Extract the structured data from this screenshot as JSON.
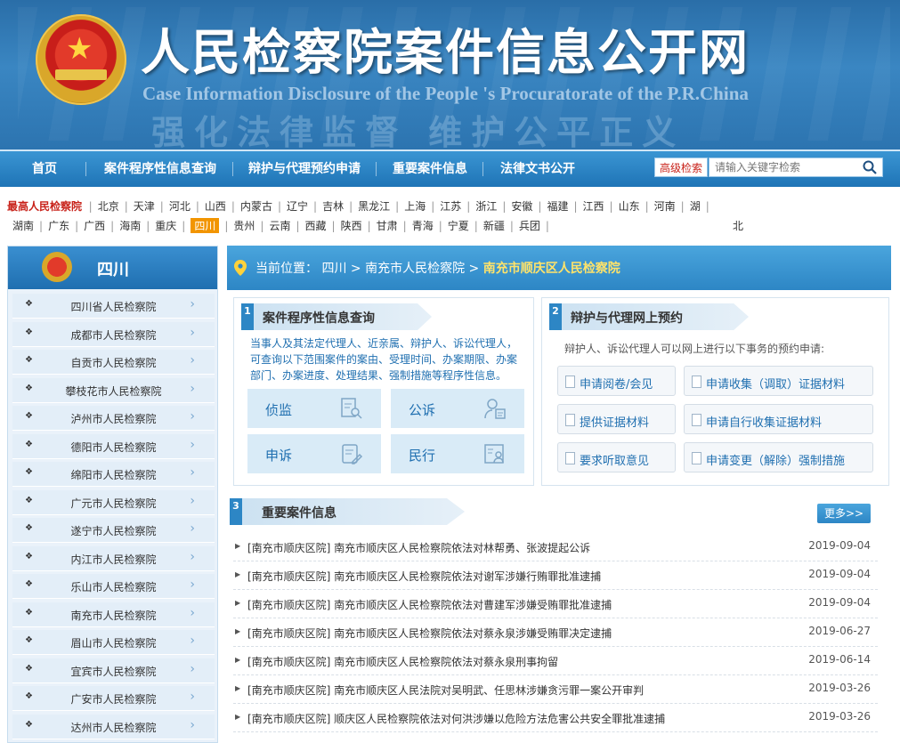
{
  "banner": {
    "title": "人民检察院案件信息公开网",
    "subtitle_en": "Case Information Disclosure of the People 's Procuratorate of the P.R.China",
    "slogan": "强化法律监督 维护公平正义"
  },
  "nav": {
    "items": [
      "首页",
      "案件程序性信息查询",
      "辩护与代理预约申请",
      "重要案件信息",
      "法律文书公开"
    ],
    "advanced_search": "高级检索",
    "search_placeholder": "请输入关键字检索"
  },
  "provinces": {
    "top": "最高人民检察院",
    "row1": [
      "北京",
      "天津",
      "河北",
      "山西",
      "内蒙古",
      "辽宁",
      "吉林",
      "黑龙江",
      "上海",
      "江苏",
      "浙江",
      "安徽",
      "福建",
      "江西",
      "山东",
      "河南",
      "湖"
    ],
    "row2": [
      "湖南",
      "广东",
      "广西",
      "海南",
      "重庆",
      "四川",
      "贵州",
      "云南",
      "西藏",
      "陕西",
      "甘肃",
      "青海",
      "宁夏",
      "新疆",
      "兵团"
    ],
    "row2_tail": "北",
    "selected": "四川"
  },
  "sidebar": {
    "title": "四川",
    "items": [
      "四川省人民检察院",
      "成都市人民检察院",
      "自贡市人民检察院",
      "攀枝花市人民检察院",
      "泸州市人民检察院",
      "德阳市人民检察院",
      "绵阳市人民检察院",
      "广元市人民检察院",
      "遂宁市人民检察院",
      "内江市人民检察院",
      "乐山市人民检察院",
      "南充市人民检察院",
      "眉山市人民检察院",
      "宜宾市人民检察院",
      "广安市人民检察院",
      "达州市人民检察院"
    ]
  },
  "breadcrumb": {
    "label": "当前位置：",
    "l1": "四川",
    "sep": " > ",
    "l2": "南充市人民检察院",
    "current": "南充市顺庆区人民检察院"
  },
  "query": {
    "num": "1",
    "title": "案件程序性信息查询",
    "desc_lines": [
      "当事人及其法定代理人、近亲属、辩护人、诉讼代理人，",
      "可查询以下范围案件的案由、受理时间、办案期限、办案",
      "部门、办案进度、处理结果、强制措施等程序性信息。"
    ],
    "tiles": [
      "侦监",
      "公诉",
      "申诉",
      "民行"
    ]
  },
  "appointment": {
    "num": "2",
    "title": "辩护与代理网上预约",
    "desc": "辩护人、诉讼代理人可以网上进行以下事务的预约申请:",
    "buttons": [
      "申请阅卷/会见",
      "申请收集（调取）证据材料",
      "提供证据材料",
      "申请自行收集证据材料",
      "要求听取意见",
      "申请变更（解除）强制措施"
    ]
  },
  "important": {
    "num": "3",
    "title": "重要案件信息",
    "more": "更多>>",
    "items": [
      {
        "title": "[南充市顺庆区院] 南充市顺庆区人民检察院依法对林帮勇、张波提起公诉",
        "date": "2019-09-04"
      },
      {
        "title": "[南充市顺庆区院] 南充市顺庆区人民检察院依法对谢军涉嫌行贿罪批准逮捕",
        "date": "2019-09-04"
      },
      {
        "title": "[南充市顺庆区院] 南充市顺庆区人民检察院依法对曹建军涉嫌受贿罪批准逮捕",
        "date": "2019-09-04"
      },
      {
        "title": "[南充市顺庆区院] 南充市顺庆区人民检察院依法对蔡永泉涉嫌受贿罪决定逮捕",
        "date": "2019-06-27"
      },
      {
        "title": "[南充市顺庆区院] 南充市顺庆区人民检察院依法对蔡永泉刑事拘留",
        "date": "2019-06-14"
      },
      {
        "title": "[南充市顺庆区院] 南充市顺庆区人民法院对吴明武、任思林涉嫌贪污罪一案公开审判",
        "date": "2019-03-26"
      },
      {
        "title": "[南充市顺庆区院] 顺庆区人民检察院依法对何洪涉嫌以危险方法危害公共安全罪批准逮捕",
        "date": "2019-03-26"
      }
    ]
  }
}
